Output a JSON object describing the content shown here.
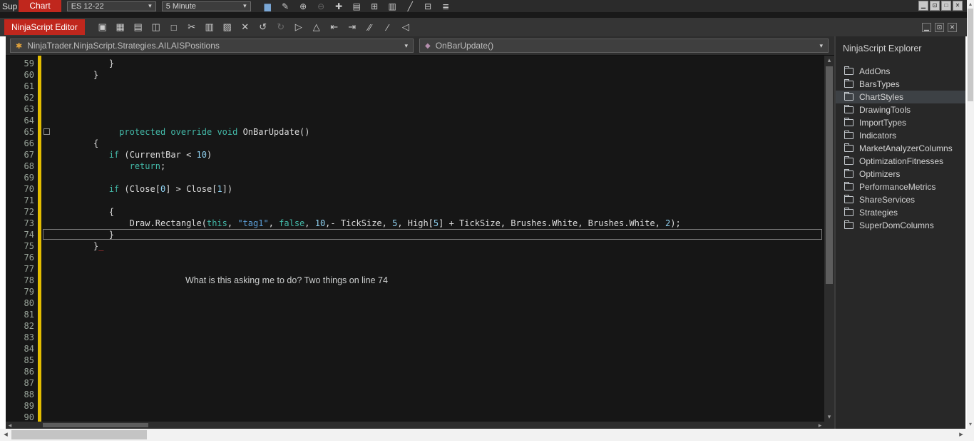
{
  "chart_window": {
    "behind_tab": "Sup",
    "chart_tab": "Chart",
    "instrument": "ES 12-22",
    "interval": "5 Minute",
    "toolbar_icons": [
      {
        "name": "chart-bars-icon",
        "glyph": "▆",
        "color": "#7aa7d6"
      },
      {
        "name": "pencil-icon",
        "glyph": "✎"
      },
      {
        "name": "zoom-in-icon",
        "glyph": "⊕"
      },
      {
        "name": "zoom-out-icon",
        "glyph": "⊖",
        "disabled": true
      },
      {
        "name": "crosshair-icon",
        "glyph": "✚"
      },
      {
        "name": "report-icon",
        "glyph": "▤"
      },
      {
        "name": "window-grid-icon",
        "glyph": "⊞"
      },
      {
        "name": "chart-type-icon",
        "glyph": "▥"
      },
      {
        "name": "trendline-icon",
        "glyph": "╱"
      },
      {
        "name": "grid-properties-icon",
        "glyph": "⊟"
      },
      {
        "name": "list-icon",
        "glyph": "≣"
      }
    ],
    "window_buttons": [
      {
        "name": "window-minimize-button",
        "glyph": "▁"
      },
      {
        "name": "window-restore-button",
        "glyph": "⊡"
      },
      {
        "name": "window-maximize-button",
        "glyph": "□"
      },
      {
        "name": "window-close-button",
        "glyph": "✕"
      }
    ]
  },
  "editor_toolbar": {
    "title": "NinjaScript Editor",
    "icons": [
      {
        "name": "save-icon",
        "glyph": "▣"
      },
      {
        "name": "save-all-icon",
        "glyph": "▦"
      },
      {
        "name": "print-icon",
        "glyph": "▤"
      },
      {
        "name": "print-preview-icon",
        "glyph": "◫"
      },
      {
        "name": "document-icon",
        "glyph": "□"
      },
      {
        "name": "cut-icon",
        "glyph": "✂"
      },
      {
        "name": "copy-icon",
        "glyph": "▥"
      },
      {
        "name": "paste-icon",
        "glyph": "▨"
      },
      {
        "name": "delete-icon",
        "glyph": "✕"
      },
      {
        "name": "undo-icon",
        "glyph": "↺"
      },
      {
        "name": "redo-icon",
        "glyph": "↻",
        "disabled": true
      },
      {
        "name": "export-icon",
        "glyph": "▷"
      },
      {
        "name": "compile-icon",
        "glyph": "△"
      },
      {
        "name": "outdent-icon",
        "glyph": "⇤"
      },
      {
        "name": "indent-icon",
        "glyph": "⇥"
      },
      {
        "name": "comment-icon",
        "glyph": "∕∕"
      },
      {
        "name": "uncomment-icon",
        "glyph": "∕"
      },
      {
        "name": "compile-run-icon",
        "glyph": "◁"
      }
    ],
    "window_buttons": [
      {
        "name": "editor-minimize-button",
        "glyph": "▁"
      },
      {
        "name": "editor-restore-button",
        "glyph": "⊡"
      },
      {
        "name": "editor-close-button",
        "glyph": "✕"
      }
    ]
  },
  "editor": {
    "class_dropdown": "NinjaTrader.NinjaScript.Strategies.AILAISPositions",
    "method_dropdown": "OnBarUpdate()",
    "code_lines": [
      {
        "n": 59,
        "seg": [
          [
            "p",
            "            }"
          ]
        ]
      },
      {
        "n": 60,
        "seg": [
          [
            "p",
            "         }"
          ]
        ]
      },
      {
        "n": 61,
        "seg": []
      },
      {
        "n": 62,
        "seg": []
      },
      {
        "n": 63,
        "seg": []
      },
      {
        "n": 64,
        "seg": []
      },
      {
        "n": 65,
        "fold": true,
        "seg": [
          [
            "p",
            "              "
          ],
          [
            "k",
            "protected"
          ],
          [
            "p",
            " "
          ],
          [
            "k",
            "override"
          ],
          [
            "p",
            " "
          ],
          [
            "k",
            "void"
          ],
          [
            "p",
            " OnBarUpdate()"
          ]
        ]
      },
      {
        "n": 66,
        "seg": [
          [
            "p",
            "         {"
          ]
        ]
      },
      {
        "n": 67,
        "seg": [
          [
            "p",
            "            "
          ],
          [
            "k",
            "if"
          ],
          [
            "p",
            " (CurrentBar < "
          ],
          [
            "num",
            "10"
          ],
          [
            "p",
            ")"
          ]
        ]
      },
      {
        "n": 68,
        "seg": [
          [
            "p",
            "                "
          ],
          [
            "k",
            "return"
          ],
          [
            "p",
            ";"
          ]
        ]
      },
      {
        "n": 69,
        "seg": []
      },
      {
        "n": 70,
        "seg": [
          [
            "p",
            "            "
          ],
          [
            "k",
            "if"
          ],
          [
            "p",
            " (Close["
          ],
          [
            "num",
            "0"
          ],
          [
            "p",
            "] > Close["
          ],
          [
            "num",
            "1"
          ],
          [
            "p",
            "])"
          ]
        ]
      },
      {
        "n": 71,
        "seg": []
      },
      {
        "n": 72,
        "seg": [
          [
            "p",
            "            {"
          ]
        ]
      },
      {
        "n": 73,
        "seg": [
          [
            "p",
            "                Draw.Rectangle("
          ],
          [
            "k",
            "this"
          ],
          [
            "p",
            ", "
          ],
          [
            "s",
            "\"tag1\""
          ],
          [
            "p",
            ", "
          ],
          [
            "k",
            "false"
          ],
          [
            "p",
            ", "
          ],
          [
            "num",
            "10"
          ],
          [
            "p",
            ",- TickSize, "
          ],
          [
            "num",
            "5"
          ],
          [
            "p",
            ", High["
          ],
          [
            "num",
            "5"
          ],
          [
            "p",
            "] + TickSize, Brushes.White, Brushes.White, "
          ],
          [
            "num",
            "2"
          ],
          [
            "p",
            ");"
          ]
        ]
      },
      {
        "n": 74,
        "current": true,
        "seg": [
          [
            "p",
            "            }"
          ]
        ]
      },
      {
        "n": 75,
        "caret": true,
        "seg": [
          [
            "p",
            "         }"
          ]
        ]
      },
      {
        "n": 76,
        "seg": []
      },
      {
        "n": 77,
        "seg": []
      },
      {
        "n": 78,
        "seg": [
          [
            "note",
            "What is this asking me to do? Two things on line 74"
          ]
        ]
      },
      {
        "n": 79,
        "seg": []
      },
      {
        "n": 80,
        "seg": []
      },
      {
        "n": 81,
        "seg": []
      },
      {
        "n": 82,
        "seg": []
      },
      {
        "n": 83,
        "seg": []
      },
      {
        "n": 84,
        "seg": []
      },
      {
        "n": 85,
        "seg": []
      },
      {
        "n": 86,
        "seg": []
      },
      {
        "n": 87,
        "seg": []
      },
      {
        "n": 88,
        "seg": []
      },
      {
        "n": 89,
        "seg": []
      },
      {
        "n": 90,
        "seg": []
      }
    ]
  },
  "explorer": {
    "title": "NinjaScript Explorer",
    "selected_item": "ChartStyles",
    "items": [
      "AddOns",
      "BarsTypes",
      "ChartStyles",
      "DrawingTools",
      "ImportTypes",
      "Indicators",
      "MarketAnalyzerColumns",
      "OptimizationFitnesses",
      "Optimizers",
      "PerformanceMetrics",
      "ShareServices",
      "Strategies",
      "SuperDomColumns"
    ]
  },
  "glyphs": {
    "chevron_down": "▾",
    "scroll_up": "▴",
    "scroll_down": "▾",
    "scroll_left": "◂",
    "scroll_right": "▸",
    "class_icon": "✱",
    "method_icon": "◆"
  },
  "colors": {
    "accent_red": "#c0271d",
    "editor_background": "#161616",
    "changed_line_indicator": "#e3bd00",
    "keyword": "#43b9a8",
    "string": "#5c9fd8",
    "number": "#8fd1f0"
  }
}
